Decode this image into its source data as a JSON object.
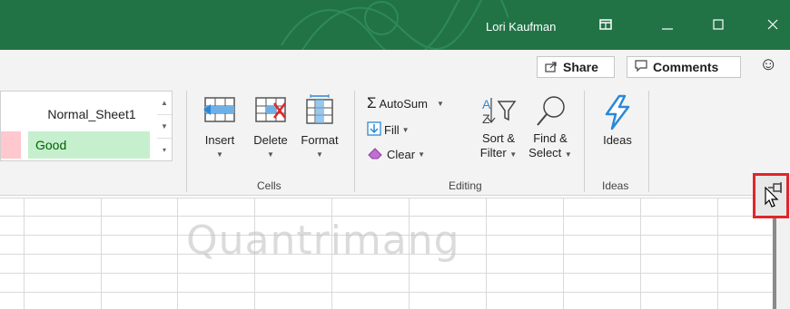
{
  "titlebar": {
    "user_name": "Lori Kaufman",
    "bg_color": "#217346",
    "buttons": [
      "restore-ribbon-icon",
      "minimize-icon",
      "maximize-icon",
      "close-icon"
    ]
  },
  "toolbar": {
    "share_label": "Share",
    "comments_label": "Comments"
  },
  "styles": {
    "normal_label": "Normal_Sheet1",
    "good_label": "Good"
  },
  "cells_group": {
    "label": "Cells",
    "insert_label": "Insert",
    "delete_label": "Delete",
    "format_label": "Format"
  },
  "editing_group": {
    "label": "Editing",
    "autosum_label": "AutoSum",
    "fill_label": "Fill",
    "clear_label": "Clear",
    "sort_line1": "Sort &",
    "sort_line2": "Filter",
    "find_line1": "Find &",
    "find_line2": "Select"
  },
  "ideas_group": {
    "label": "Ideas",
    "ideas_label": "Ideas"
  },
  "watermark": "Quantrimang",
  "colors": {
    "accent": "#217346",
    "good_fill": "#c6efce",
    "good_text": "#006100",
    "bad_fill": "#ffc7ce",
    "highlight_box": "#e0252b",
    "ideas_icon": "#2b88d8"
  }
}
